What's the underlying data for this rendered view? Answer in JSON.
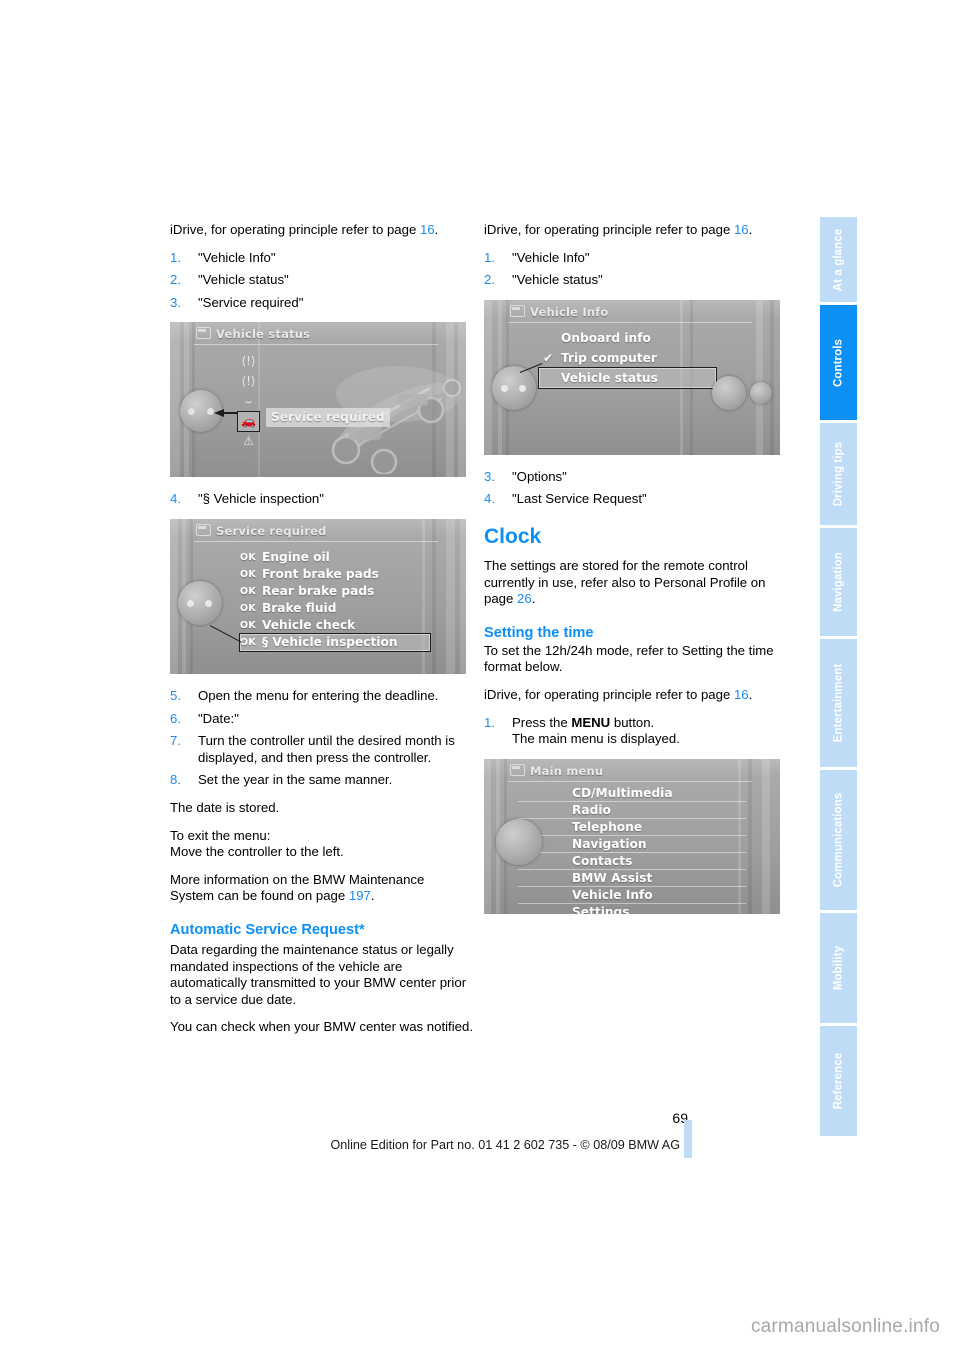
{
  "sidebar": {
    "tabs": [
      {
        "label": "At a glance",
        "active": false
      },
      {
        "label": "Controls",
        "active": true
      },
      {
        "label": "Driving tips",
        "active": false
      },
      {
        "label": "Navigation",
        "active": false
      },
      {
        "label": "Entertainment",
        "active": false
      },
      {
        "label": "Communications",
        "active": false
      },
      {
        "label": "Mobility",
        "active": false
      },
      {
        "label": "Reference",
        "active": false
      }
    ],
    "accent_active": "#0c90f5",
    "accent_inactive": "#bfdcf7"
  },
  "left_column": {
    "intro": "iDrive, for operating principle refer to page ",
    "intro_ref": "16",
    "intro_end": ".",
    "steps_a": [
      {
        "num": "1.",
        "text": "\"Vehicle Info\""
      },
      {
        "num": "2.",
        "text": "\"Vehicle status\""
      },
      {
        "num": "3.",
        "text": "\"Service required\""
      }
    ],
    "figure_vehicle_status": {
      "title": "Vehicle status",
      "callout": "Service required",
      "glyphs": [
        "(!)",
        "(!)",
        "oil",
        "car",
        "!"
      ]
    },
    "steps_b": [
      {
        "num": "4.",
        "text": "\"§ Vehicle inspection\""
      }
    ],
    "figure_service_required": {
      "title": "Service required",
      "rows": [
        {
          "ok": "OK",
          "label": "Engine oil",
          "selected": false
        },
        {
          "ok": "OK",
          "label": "Front brake pads",
          "selected": false
        },
        {
          "ok": "OK",
          "label": "Rear brake pads",
          "selected": false
        },
        {
          "ok": "OK",
          "label": "Brake fluid",
          "selected": false
        },
        {
          "ok": "OK",
          "label": "Vehicle check",
          "selected": false
        },
        {
          "ok": "OK",
          "label": "§ Vehicle inspection",
          "selected": true
        }
      ]
    },
    "steps_c": [
      {
        "num": "5.",
        "text": "Open the menu for entering the deadline."
      },
      {
        "num": "6.",
        "text": "\"Date:\""
      },
      {
        "num": "7.",
        "text": "Turn the controller until the desired month is displayed, and then press the controller."
      },
      {
        "num": "8.",
        "text": "Set the year in the same manner."
      }
    ],
    "para_date_stored": "The date is stored.",
    "para_exit_1": "To exit the menu:",
    "para_exit_2": "Move the controller to the left.",
    "para_more_1": "More information on the BMW Maintenance",
    "para_more_2": "System can be found on page ",
    "para_more_ref": "197",
    "para_more_end": ".",
    "heading_auto_service": "Automatic Service Request*",
    "para_auto_1": "Data regarding the maintenance status or legally mandated inspections of the vehicle are automatically transmitted to your BMW center prior to a service due date.",
    "para_auto_2": "You can check when your BMW center was notified."
  },
  "right_column": {
    "intro": "iDrive, for operating principle refer to page ",
    "intro_ref": "16",
    "intro_end": ".",
    "steps_a": [
      {
        "num": "1.",
        "text": "\"Vehicle Info\""
      },
      {
        "num": "2.",
        "text": "\"Vehicle status\""
      }
    ],
    "figure_vehicle_info": {
      "title": "Vehicle Info",
      "rows": [
        {
          "label": "Onboard info",
          "checked": false,
          "selected": false
        },
        {
          "label": "Trip computer",
          "checked": true,
          "selected": false
        },
        {
          "label": "Vehicle status",
          "checked": false,
          "selected": true
        }
      ]
    },
    "steps_b": [
      {
        "num": "3.",
        "text": "\"Options\""
      },
      {
        "num": "4.",
        "text": "\"Last Service Request\""
      }
    ],
    "heading_clock": "Clock",
    "para_clock_1": "The settings are stored for the remote control currently in use, refer also to Personal Profile on page ",
    "para_clock_ref": "26",
    "para_clock_end": ".",
    "heading_setting_time": "Setting the time",
    "para_set_1": "To set the 12h/24h mode, refer to Setting the time format below.",
    "para_set_2": "iDrive, for operating principle refer to page ",
    "para_set_ref": "16",
    "para_set_end": ".",
    "step_menu_num": "1.",
    "step_menu_pre": "Press the ",
    "step_menu_bold": "MENU",
    "step_menu_post": " button.",
    "step_menu_line2": "The main menu is displayed.",
    "figure_main_menu": {
      "title": "Main menu",
      "rows": [
        {
          "label": "CD/Multimedia"
        },
        {
          "label": "Radio"
        },
        {
          "label": "Telephone"
        },
        {
          "label": "Navigation"
        },
        {
          "label": "Contacts"
        },
        {
          "label": "BMW Assist"
        },
        {
          "label": "Vehicle Info"
        },
        {
          "label": "Settings"
        }
      ]
    }
  },
  "footer": {
    "page_number": "69",
    "line": "Online Edition for Part no. 01 41 2 602 735 - © 08/09 BMW AG"
  },
  "watermark": "carmanualsonline.info"
}
